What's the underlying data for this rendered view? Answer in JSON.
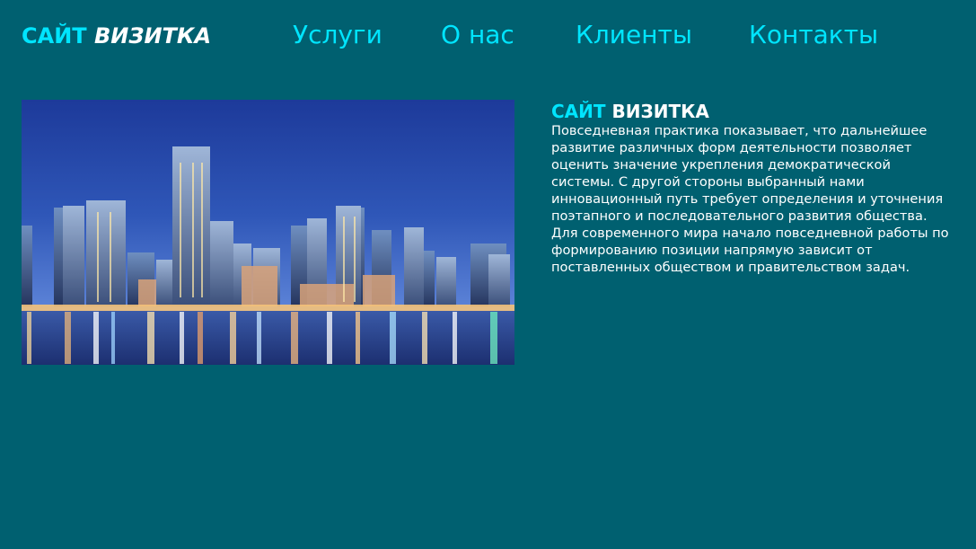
{
  "header": {
    "logo_part1": "САЙТ",
    "logo_part2": "ВИЗИТКА"
  },
  "nav": {
    "items": [
      "Услуги",
      "О нас",
      "Клиенты",
      "Контакты"
    ]
  },
  "content": {
    "title_part1": "САЙТ",
    "title_part2": "ВИЗИТКА",
    "text": "Повседневная практика показывает, что дальнейшее развитие различных форм деятельности позволяет оценить значение укрепления демократической системы. С другой стороны выбранный нами инновационный путь требует определения и уточнения поэтапного и последовательного развития общества. Для современного мира начало повседневной работы по формированию позиции напрямую зависит от поставленных обществом и правительством задач."
  },
  "colors": {
    "background": "#006070",
    "accent": "#00e5ff",
    "text": "#ffffff"
  }
}
